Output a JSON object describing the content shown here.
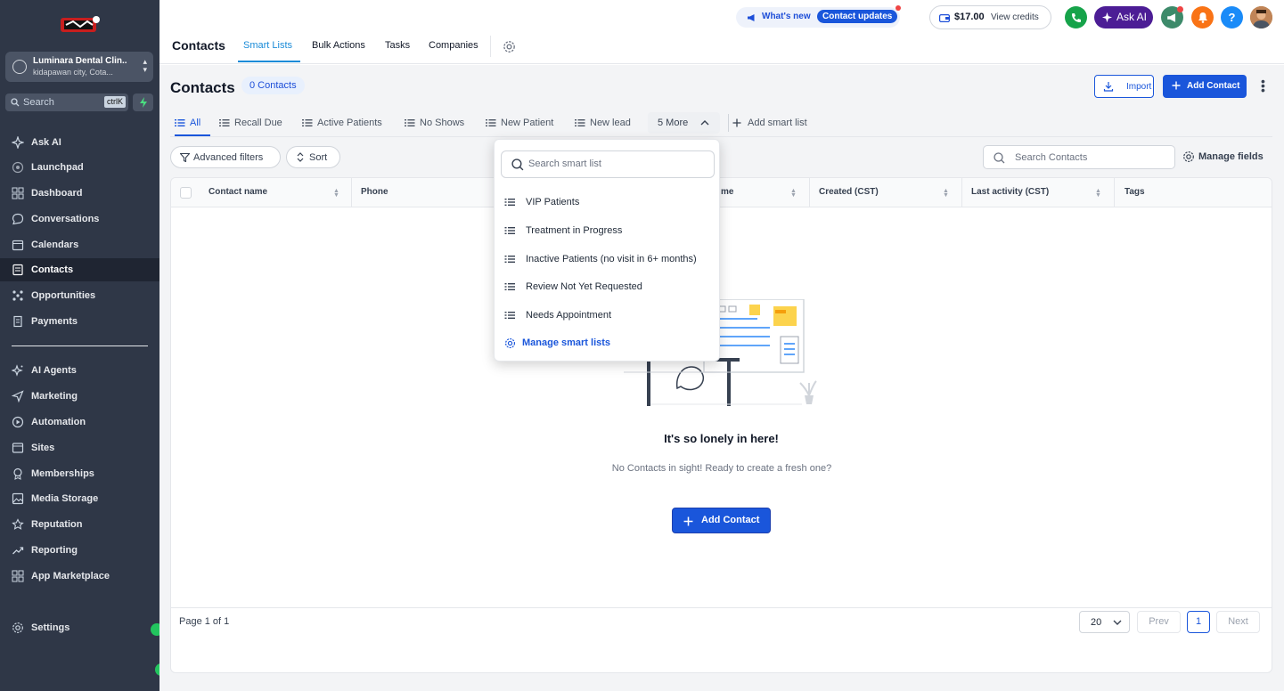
{
  "sidebar": {
    "account": {
      "name": "Luminara Dental Clin...",
      "location": "kidapawan city, Cota..."
    },
    "search": {
      "placeholder": "Search",
      "shortcut": "ctrlK"
    },
    "nav": [
      {
        "label": "Ask AI",
        "icon": "sparkle-icon"
      },
      {
        "label": "Launchpad",
        "icon": "rocket-icon"
      },
      {
        "label": "Dashboard",
        "icon": "grid-icon"
      },
      {
        "label": "Conversations",
        "icon": "chat-icon"
      },
      {
        "label": "Calendars",
        "icon": "calendar-icon"
      },
      {
        "label": "Contacts",
        "icon": "contacts-icon",
        "active": true
      },
      {
        "label": "Opportunities",
        "icon": "funnel-icon"
      },
      {
        "label": "Payments",
        "icon": "receipt-icon"
      }
    ],
    "nav2": [
      {
        "label": "AI Agents",
        "icon": "sparkle-icon"
      },
      {
        "label": "Marketing",
        "icon": "send-icon"
      },
      {
        "label": "Automation",
        "icon": "automation-icon"
      },
      {
        "label": "Sites",
        "icon": "sites-icon"
      },
      {
        "label": "Memberships",
        "icon": "membership-icon"
      },
      {
        "label": "Media Storage",
        "icon": "image-icon"
      },
      {
        "label": "Reputation",
        "icon": "star-icon"
      },
      {
        "label": "Reporting",
        "icon": "trend-icon"
      },
      {
        "label": "App Marketplace",
        "icon": "apps-icon"
      }
    ],
    "settings": "Settings"
  },
  "topbar": {
    "title": "Contacts",
    "tabs": [
      "Smart Lists",
      "Bulk Actions",
      "Tasks",
      "Companies"
    ],
    "whats_new": "What's new",
    "updates_badge": "Contact updates",
    "credits_amount": "$17.00",
    "credits_label": "View credits",
    "ask_ai": "Ask AI",
    "help": "?"
  },
  "main": {
    "heading": "Contacts",
    "count": "0 Contacts",
    "import": "Import",
    "add_contact": "Add Contact",
    "smart_lists": [
      "All",
      "Recall Due",
      "Active Patients",
      "No Shows",
      "New Patient",
      "New lead"
    ],
    "more": "5 More",
    "add_smart_list": "Add smart list",
    "advanced_filters": "Advanced filters",
    "sort": "Sort",
    "search_placeholder": "Search Contacts",
    "manage_fields": "Manage fields",
    "columns": [
      "Contact name",
      "Phone",
      "me",
      "Created (CST)",
      "Last activity (CST)",
      "Tags"
    ],
    "empty_title": "It's so lonely in here!",
    "empty_subtitle": "No Contacts in sight! Ready to create a fresh one?",
    "empty_button": "Add Contact",
    "page_info": "Page 1 of 1",
    "page_size": "20",
    "prev": "Prev",
    "page": "1",
    "next": "Next"
  },
  "dropdown": {
    "search_placeholder": "Search smart list",
    "items": [
      "VIP Patients",
      "Treatment in Progress",
      "Inactive Patients (no visit in 6+ months)",
      "Review Not Yet Requested",
      "Needs Appointment"
    ],
    "manage": "Manage smart lists"
  },
  "colors": {
    "sidebar": "#2f3747",
    "accent": "#1a56db",
    "tab_active": "#1a8bd8"
  }
}
